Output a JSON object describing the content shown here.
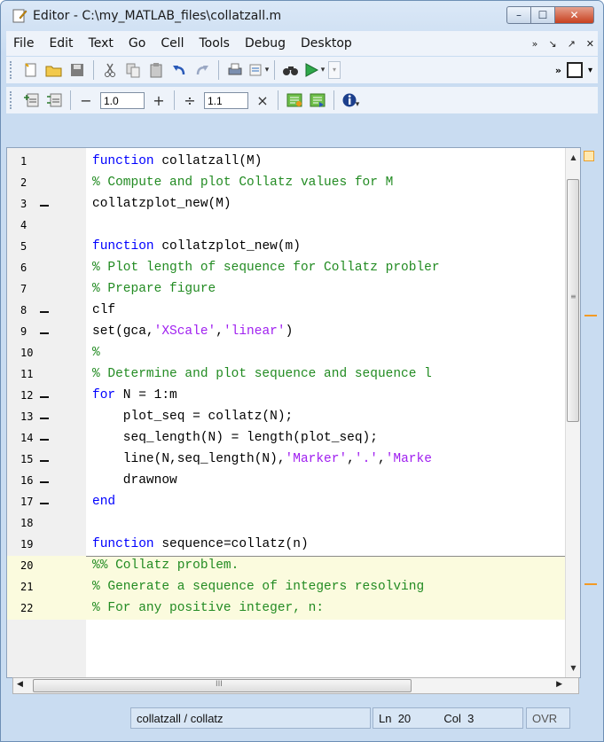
{
  "window": {
    "title": "Editor - C:\\my_MATLAB_files\\collatzall.m",
    "controls": {
      "minimize": "–",
      "maximize": "☐",
      "close": "✕"
    }
  },
  "menu": {
    "items": [
      "File",
      "Edit",
      "Text",
      "Go",
      "Cell",
      "Tools",
      "Debug",
      "Desktop"
    ],
    "right_glyphs": [
      "»",
      "↘",
      "↗",
      "✕"
    ]
  },
  "toolbar_cells": {
    "field1": "1.0",
    "field2": "1.1",
    "minus": "−",
    "plus": "+",
    "divide": "÷",
    "times": "×"
  },
  "code_lines": [
    {
      "n": "1",
      "dash": false,
      "cell": false,
      "tokens": [
        [
          "kw",
          "function"
        ],
        [
          "",
          "collatzall(M)"
        ]
      ],
      "raw": "function collatzall(M)"
    },
    {
      "n": "2",
      "dash": false,
      "cell": false,
      "raw": "% Compute and plot Collatz values for M"
    },
    {
      "n": "3",
      "dash": true,
      "cell": false,
      "raw": "collatzplot_new(M)"
    },
    {
      "n": "4",
      "dash": false,
      "cell": false,
      "raw": ""
    },
    {
      "n": "5",
      "dash": false,
      "cell": false,
      "raw": "function collatzplot_new(m)"
    },
    {
      "n": "6",
      "dash": false,
      "cell": false,
      "raw": "% Plot length of sequence for Collatz probler"
    },
    {
      "n": "7",
      "dash": false,
      "cell": false,
      "raw": "% Prepare figure"
    },
    {
      "n": "8",
      "dash": true,
      "cell": false,
      "raw": "clf"
    },
    {
      "n": "9",
      "dash": true,
      "cell": false,
      "raw": "set(gca,'XScale','linear')"
    },
    {
      "n": "10",
      "dash": false,
      "cell": false,
      "raw": "%"
    },
    {
      "n": "11",
      "dash": false,
      "cell": false,
      "raw": "% Determine and plot sequence and sequence l"
    },
    {
      "n": "12",
      "dash": true,
      "cell": false,
      "raw": "for N = 1:m"
    },
    {
      "n": "13",
      "dash": true,
      "cell": false,
      "raw": "    plot_seq = collatz(N);"
    },
    {
      "n": "14",
      "dash": true,
      "cell": false,
      "raw": "    seq_length(N) = length(plot_seq);"
    },
    {
      "n": "15",
      "dash": true,
      "cell": false,
      "raw": "    line(N,seq_length(N),'Marker','.','Marke"
    },
    {
      "n": "16",
      "dash": true,
      "cell": false,
      "raw": "    drawnow"
    },
    {
      "n": "17",
      "dash": true,
      "cell": false,
      "raw": "end"
    },
    {
      "n": "18",
      "dash": false,
      "cell": false,
      "raw": ""
    },
    {
      "n": "19",
      "dash": false,
      "cell": false,
      "raw": "function sequence=collatz(n)"
    },
    {
      "n": "20",
      "dash": false,
      "cell": true,
      "raw": "%% Collatz problem."
    },
    {
      "n": "21",
      "dash": false,
      "cell": true,
      "raw": "% Generate a sequence of integers resolving"
    },
    {
      "n": "22",
      "dash": false,
      "cell": true,
      "raw": "% For any positive integer, n:"
    }
  ],
  "scroll": {
    "hgrip": "III",
    "vgrip": "≡"
  },
  "status": {
    "context": "collatzall / collatz",
    "ln_label": "Ln",
    "ln": "20",
    "col_label": "Col",
    "col": "3",
    "mode": "OVR"
  },
  "colors": {
    "keyword": "#0000ff",
    "comment": "#228b22",
    "string": "#a020f0",
    "cell_bg": "#fbfbde",
    "marker": "#f39a24"
  }
}
